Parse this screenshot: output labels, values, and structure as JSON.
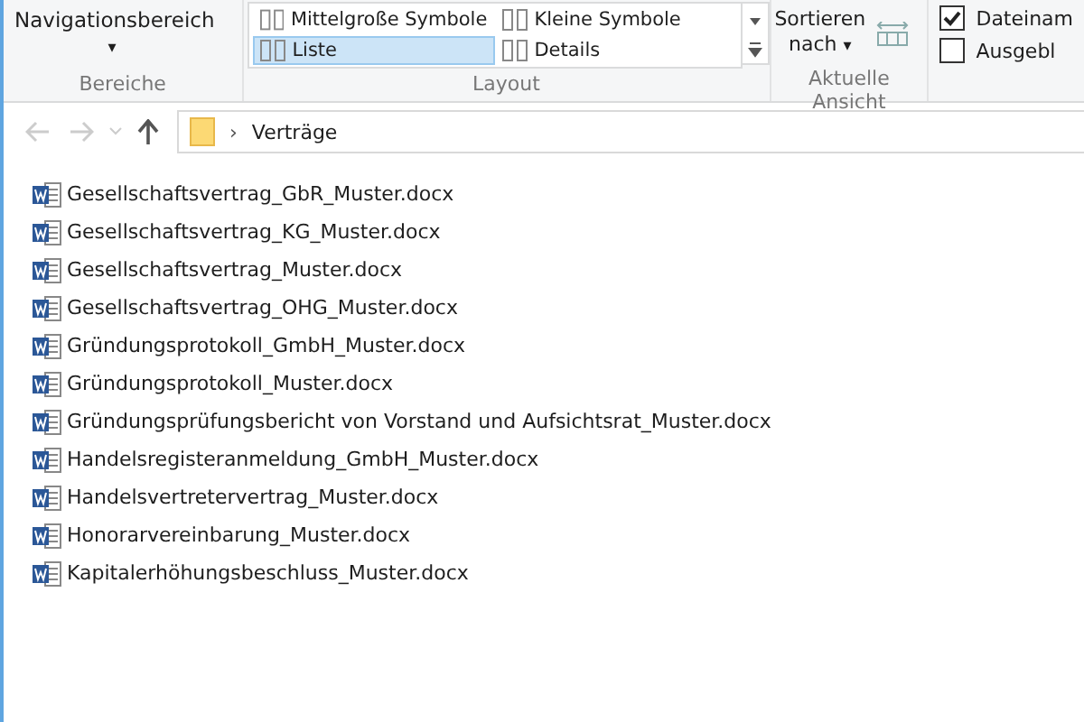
{
  "ribbon": {
    "panes": {
      "label": "Navigationsbereich",
      "caret": "▾",
      "group": "Bereiche"
    },
    "layout": {
      "items": [
        {
          "label": "Mittelgroße Symbole",
          "selected": false
        },
        {
          "label": "Kleine Symbole",
          "selected": false
        },
        {
          "label": "Liste",
          "selected": true
        },
        {
          "label": "Details",
          "selected": false
        }
      ],
      "group": "Layout"
    },
    "view": {
      "sort": "Sortieren",
      "sort2": "nach",
      "caret": "▾",
      "group": "Aktuelle Ansicht"
    },
    "show": [
      {
        "label": "Dateinam",
        "checked": true
      },
      {
        "label": "Ausgebl",
        "checked": false
      }
    ]
  },
  "address": {
    "path": "Verträge",
    "separator": "›"
  },
  "files": [
    {
      "name": "Gesellschaftsvertrag_GbR_Muster.docx"
    },
    {
      "name": "Gesellschaftsvertrag_KG_Muster.docx"
    },
    {
      "name": "Gesellschaftsvertrag_Muster.docx"
    },
    {
      "name": "Gesellschaftsvertrag_OHG_Muster.docx"
    },
    {
      "name": "Gründungsprotokoll_GmbH_Muster.docx"
    },
    {
      "name": "Gründungsprotokoll_Muster.docx"
    },
    {
      "name": "Gründungsprüfungsbericht von Vorstand und Aufsichtsrat_Muster.docx"
    },
    {
      "name": "Handelsregisteranmeldung_GmbH_Muster.docx"
    },
    {
      "name": "Handelsvertretervertrag_Muster.docx"
    },
    {
      "name": "Honorarvereinbarung_Muster.docx"
    },
    {
      "name": "Kapitalerhöhungsbeschluss_Muster.docx"
    }
  ]
}
